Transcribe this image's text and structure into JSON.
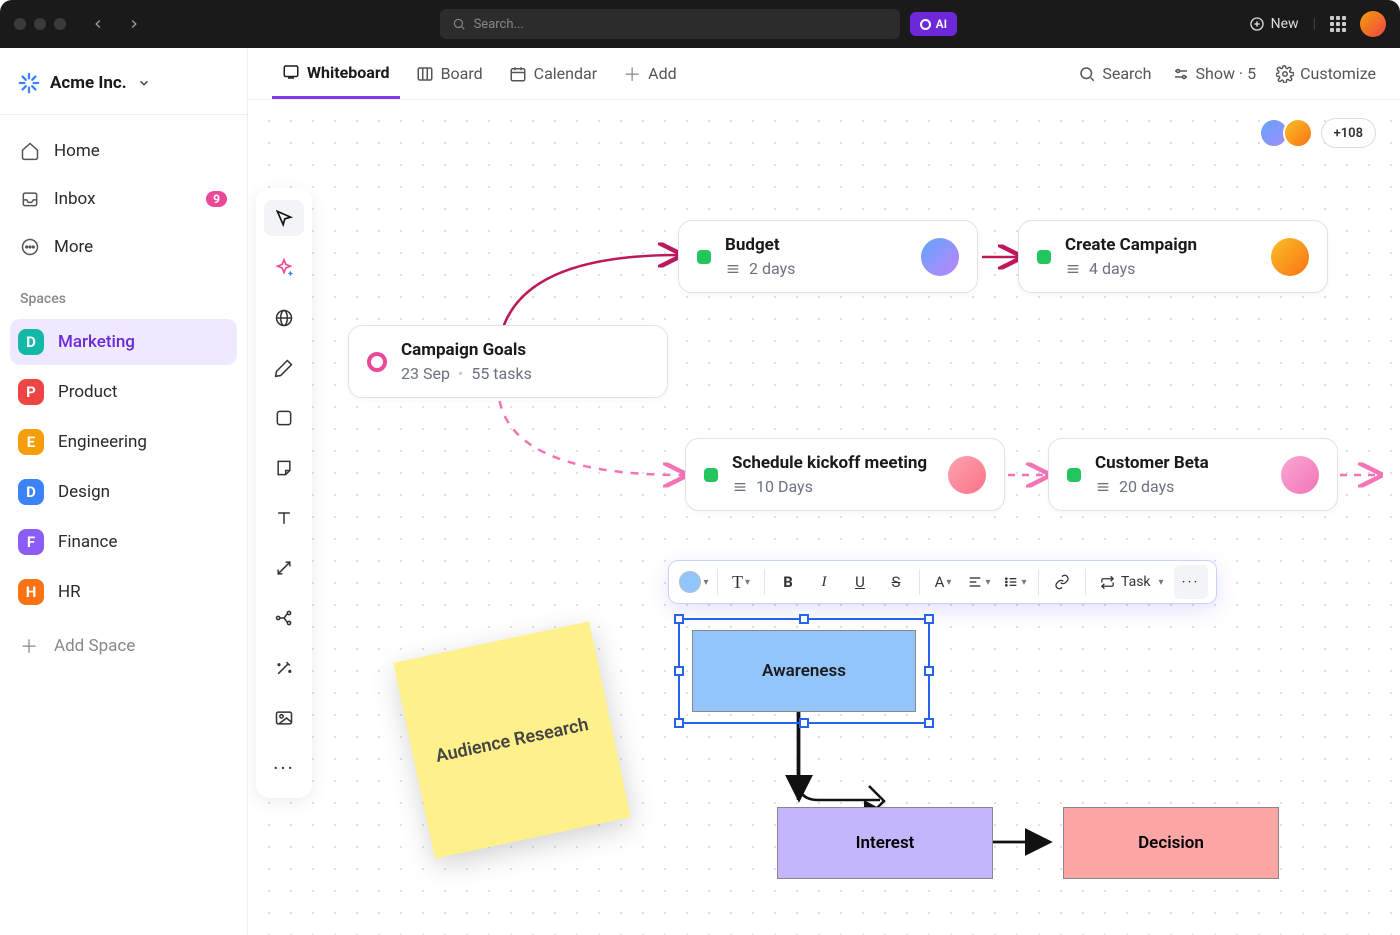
{
  "title_bar": {
    "search_placeholder": "Search...",
    "ai_label": "AI",
    "new_label": "New"
  },
  "workspace": {
    "name": "Acme Inc."
  },
  "nav": {
    "home": "Home",
    "inbox": "Inbox",
    "inbox_badge": "9",
    "more": "More",
    "spaces_label": "Spaces",
    "add_space": "Add Space"
  },
  "spaces": [
    {
      "letter": "D",
      "name": "Marketing",
      "color": "#14b8a6",
      "active": true
    },
    {
      "letter": "P",
      "name": "Product",
      "color": "#ef4444"
    },
    {
      "letter": "E",
      "name": "Engineering",
      "color": "#f59e0b"
    },
    {
      "letter": "D",
      "name": "Design",
      "color": "#3b82f6"
    },
    {
      "letter": "F",
      "name": "Finance",
      "color": "#8b5cf6"
    },
    {
      "letter": "H",
      "name": "HR",
      "color": "#f97316"
    }
  ],
  "views": {
    "whiteboard": "Whiteboard",
    "board": "Board",
    "calendar": "Calendar",
    "add": "Add",
    "search": "Search",
    "show": "Show · 5",
    "customize": "Customize"
  },
  "presence_overflow": "+108",
  "cards": {
    "goals": {
      "title": "Campaign Goals",
      "sub_date": "23 Sep",
      "sub_tasks": "55 tasks"
    },
    "budget": {
      "title": "Budget",
      "sub": "2 days",
      "status": "#22c55e"
    },
    "create": {
      "title": "Create Campaign",
      "sub": "4 days",
      "status": "#22c55e"
    },
    "kickoff": {
      "title": "Schedule kickoff meeting",
      "sub": "10 Days",
      "status": "#22c55e"
    },
    "beta": {
      "title": "Customer Beta",
      "sub": "20 days",
      "status": "#22c55e"
    }
  },
  "sticky": {
    "text": "Audience Research"
  },
  "shapes": {
    "awareness": "Awareness",
    "interest": "Interest",
    "decision": "Decision"
  },
  "format_bar": {
    "task": "Task",
    "bold": "B",
    "italic": "I",
    "underline": "U",
    "strike": "S",
    "text": "T",
    "font_color": "A"
  }
}
